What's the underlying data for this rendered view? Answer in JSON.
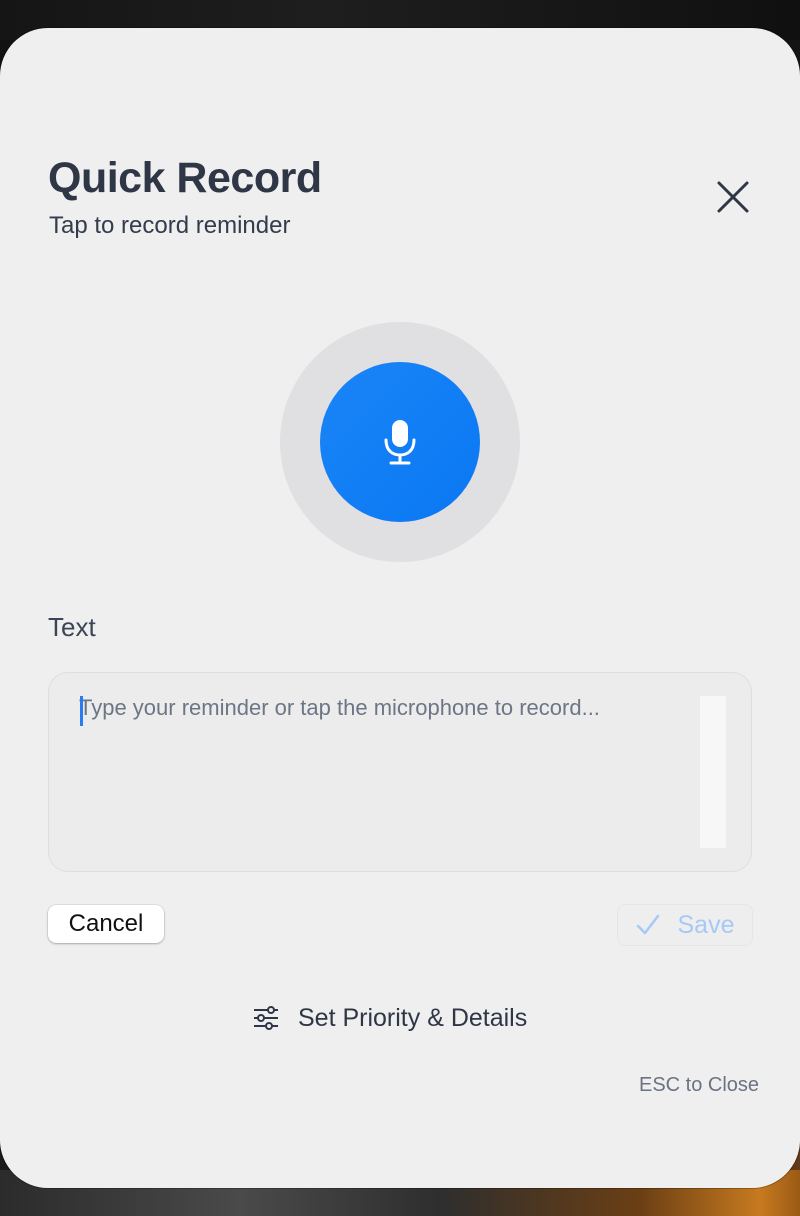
{
  "dialog": {
    "title": "Quick Record",
    "subtitle": "Tap to record reminder"
  },
  "icons": {
    "close": "close-icon",
    "microphone": "microphone-icon",
    "save": "checkmark-icon",
    "details": "sliders-icon"
  },
  "input": {
    "label": "Text",
    "value": "",
    "placeholder": "Type your reminder or tap the microphone to record..."
  },
  "actions": {
    "cancel_label": "Cancel",
    "save_label": "Save",
    "details_label": "Set Priority & Details"
  },
  "hint": {
    "esc": "ESC to Close"
  },
  "colors": {
    "accent": "#0a78f4",
    "save_disabled": "#a6c9f6"
  }
}
